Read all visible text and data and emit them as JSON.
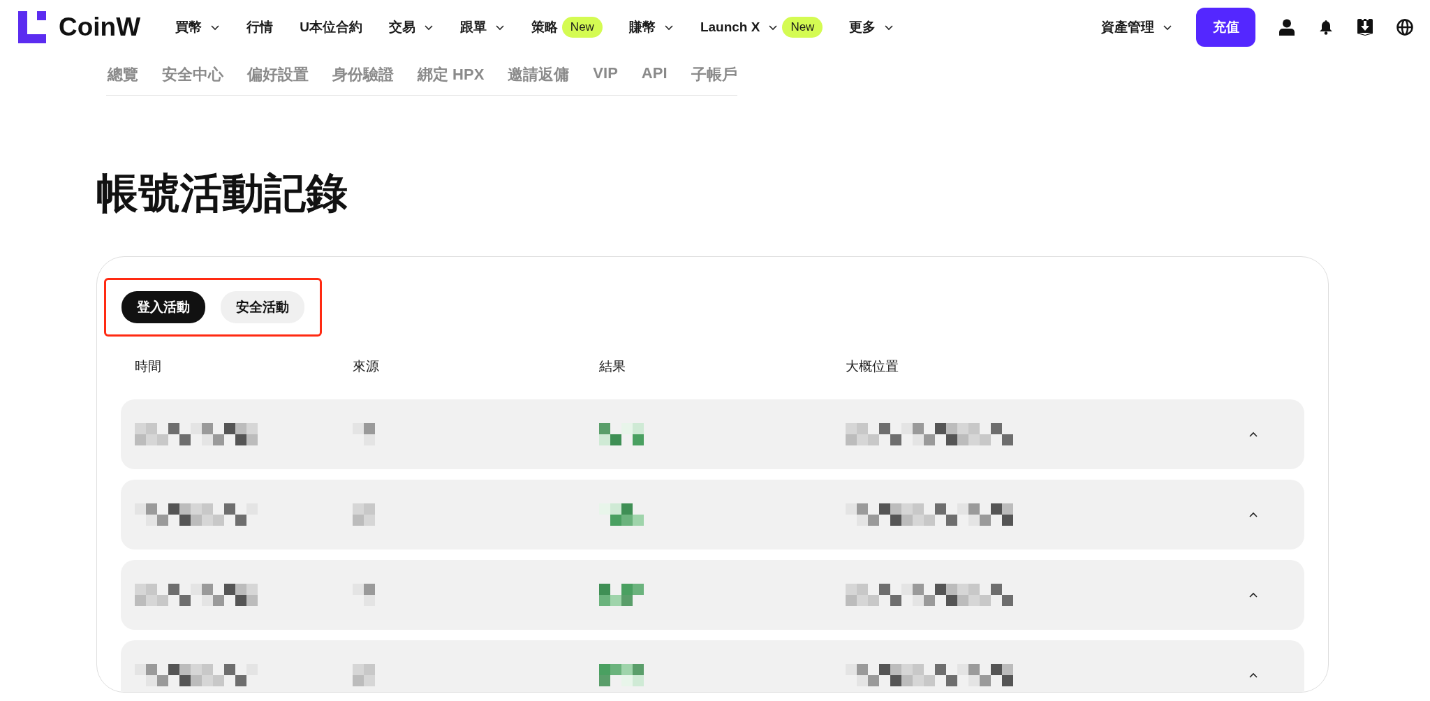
{
  "logo": {
    "text": "CoinW"
  },
  "nav": [
    {
      "label": "買幣",
      "has_menu": true
    },
    {
      "label": "行情",
      "has_menu": false
    },
    {
      "label": "U本位合約",
      "has_menu": false
    },
    {
      "label": "交易",
      "has_menu": true
    },
    {
      "label": "跟單",
      "has_menu": true
    },
    {
      "label": "策略",
      "has_menu": false,
      "badge": "New"
    },
    {
      "label": "賺幣",
      "has_menu": true
    },
    {
      "label": "Launch X",
      "has_menu": true,
      "badge": "New"
    },
    {
      "label": "更多",
      "has_menu": true
    }
  ],
  "assets_menu": {
    "label": "資產管理",
    "has_menu": true
  },
  "deposit_button": "充值",
  "account_nav": [
    "總覽",
    "安全中心",
    "偏好設置",
    "身份驗證",
    "綁定 HPX",
    "邀請返傭",
    "VIP",
    "API",
    "子帳戶"
  ],
  "page_title": "帳號活動記錄",
  "tabs": [
    {
      "label": "登入活動",
      "selected": true
    },
    {
      "label": "安全活動",
      "selected": false
    }
  ],
  "table": {
    "columns": [
      "時間",
      "來源",
      "結果",
      "大概位置"
    ],
    "rows": [
      {
        "kind": "redacted"
      },
      {
        "kind": "redacted"
      },
      {
        "kind": "redacted"
      },
      {
        "kind": "redacted"
      }
    ]
  }
}
